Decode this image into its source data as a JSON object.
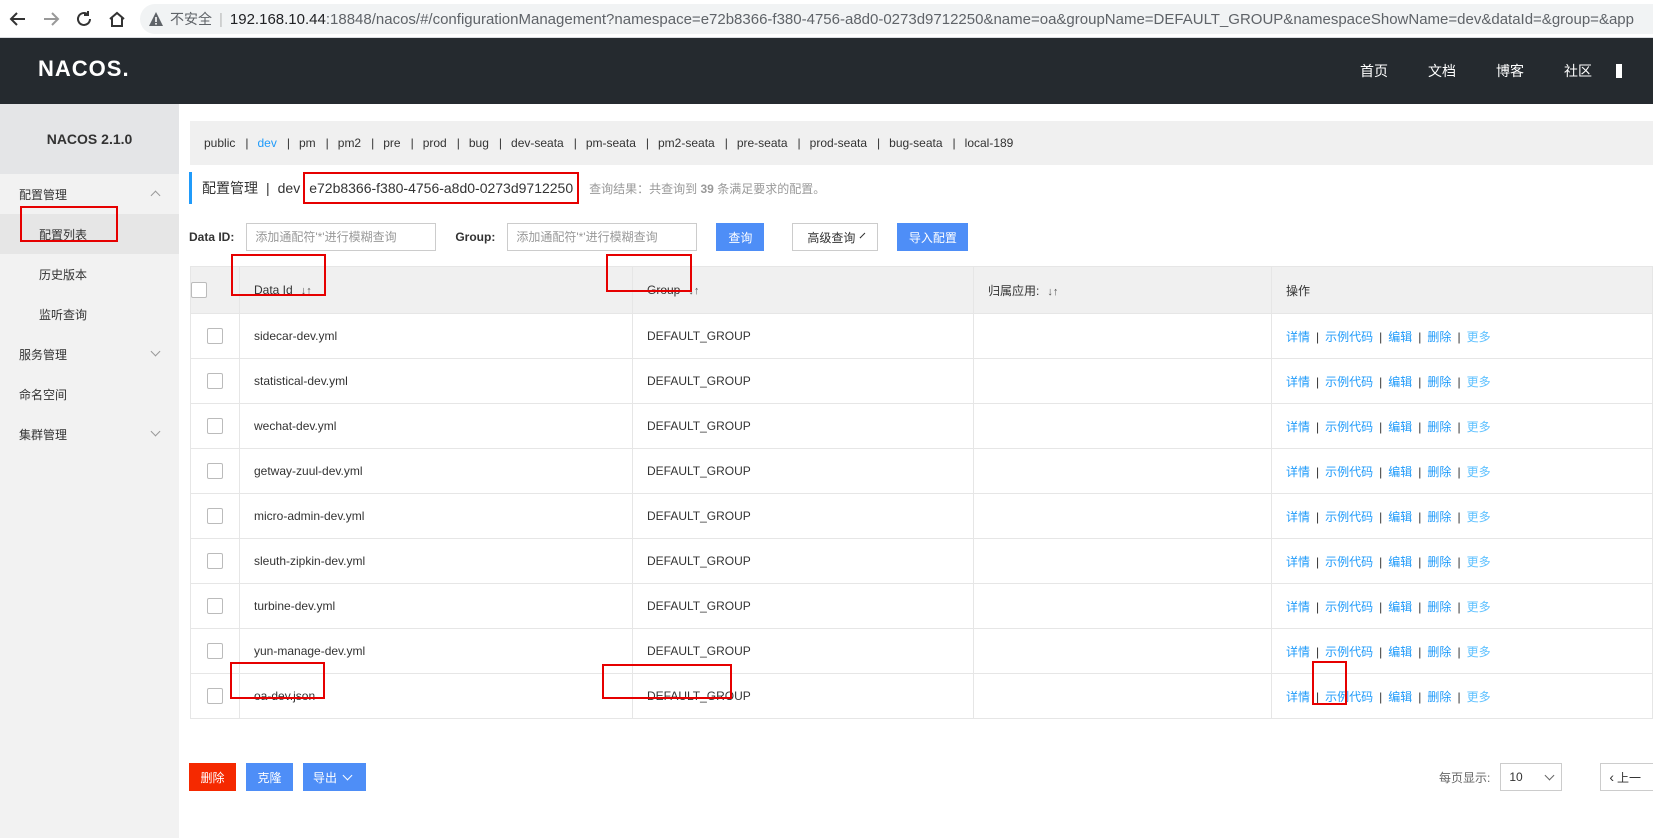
{
  "browser": {
    "insecure_label": "不安全",
    "url_host": "192.168.10.44",
    "url_rest": ":18848/nacos/#/configurationManagement?namespace=e72b8366-f380-4756-a8d0-0273d9712250&name=oa&groupName=DEFAULT_GROUP&namespaceShowName=dev&dataId=&group=&app"
  },
  "header": {
    "logo_na": "NA",
    "logo_co": "C",
    "logo_os": "OS.",
    "nav": [
      "首页",
      "文档",
      "博客",
      "社区"
    ]
  },
  "sidebar": {
    "version": "NACOS 2.1.0",
    "items": [
      {
        "label": "配置管理"
      },
      {
        "label": "配置列表"
      },
      {
        "label": "历史版本"
      },
      {
        "label": "监听查询"
      },
      {
        "label": "服务管理"
      },
      {
        "label": "命名空间"
      },
      {
        "label": "集群管理"
      }
    ]
  },
  "namespaces": [
    "public",
    "dev",
    "pm",
    "pm2",
    "pre",
    "prod",
    "bug",
    "dev-seata",
    "pm-seata",
    "pm2-seata",
    "pre-seata",
    "prod-seata",
    "bug-seata",
    "local-189"
  ],
  "title": {
    "section": "配置管理",
    "sep": "|",
    "ns_name": "dev",
    "ns_id": "e72b8366-f380-4756-a8d0-0273d9712250",
    "result_prefix": "查询结果：共查询到",
    "result_count": "39",
    "result_suffix": "条满足要求的配置。"
  },
  "search": {
    "dataid_label": "Data ID:",
    "dataid_placeholder": "添加通配符'*'进行模糊查询",
    "group_label": "Group:",
    "group_placeholder": "添加通配符'*'进行模糊查询",
    "query_btn": "查询",
    "advanced_btn": "高级查询",
    "import_btn": "导入配置"
  },
  "table": {
    "headers": {
      "data_id": "Data Id",
      "group": "Group",
      "app": "归属应用:",
      "ops": "操作"
    },
    "sort_icon": "↓↑",
    "ops": {
      "detail": "详情",
      "sample": "示例代码",
      "edit": "编辑",
      "delete": "删除",
      "more": "更多",
      "sep": "|"
    },
    "rows": [
      {
        "data_id": "sidecar-dev.yml",
        "group": "DEFAULT_GROUP",
        "app": ""
      },
      {
        "data_id": "statistical-dev.yml",
        "group": "DEFAULT_GROUP",
        "app": ""
      },
      {
        "data_id": "wechat-dev.yml",
        "group": "DEFAULT_GROUP",
        "app": ""
      },
      {
        "data_id": "getway-zuul-dev.yml",
        "group": "DEFAULT_GROUP",
        "app": ""
      },
      {
        "data_id": "micro-admin-dev.yml",
        "group": "DEFAULT_GROUP",
        "app": ""
      },
      {
        "data_id": "sleuth-zipkin-dev.yml",
        "group": "DEFAULT_GROUP",
        "app": ""
      },
      {
        "data_id": "turbine-dev.yml",
        "group": "DEFAULT_GROUP",
        "app": ""
      },
      {
        "data_id": "yun-manage-dev.yml",
        "group": "DEFAULT_GROUP",
        "app": ""
      },
      {
        "data_id": "oa-dev.json",
        "group": "DEFAULT_GROUP",
        "app": ""
      }
    ]
  },
  "footer": {
    "delete_btn": "删除",
    "clone_btn": "克隆",
    "export_btn": "导出",
    "page_size_label": "每页显示:",
    "page_size": "10",
    "prev_btn": "上一"
  },
  "colors": {
    "header_bg": "#252a2f",
    "link": "#209bfa",
    "primary_btn": "#4e8ef7",
    "danger_btn": "#f52900",
    "annotation": "#e60000"
  }
}
